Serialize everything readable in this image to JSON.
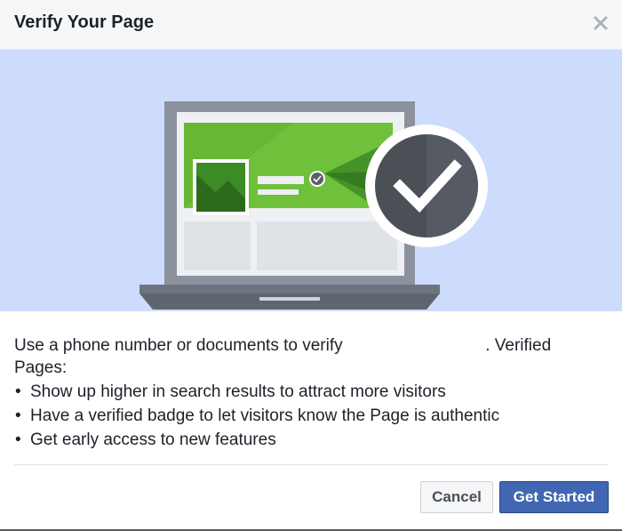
{
  "dialog": {
    "title": "Verify Your Page",
    "close_icon": "close-icon"
  },
  "hero": {
    "illustration": "laptop-with-verified-check-illustration",
    "colors": {
      "background": "#cddcfd",
      "green": "#6fc13b",
      "check_circle": "#4b4f56"
    }
  },
  "body": {
    "intro_before": "Use a phone number or documents to verify",
    "intro_after": ". Verified",
    "intro_line2": "Pages:",
    "benefits": [
      "Show up higher in search results to attract more visitors",
      "Have a verified badge to let visitors know the Page is authentic",
      "Get early access to new features"
    ],
    "bullet": "•"
  },
  "footer": {
    "cancel_label": "Cancel",
    "primary_label": "Get Started",
    "primary_color": "#4267b2"
  }
}
